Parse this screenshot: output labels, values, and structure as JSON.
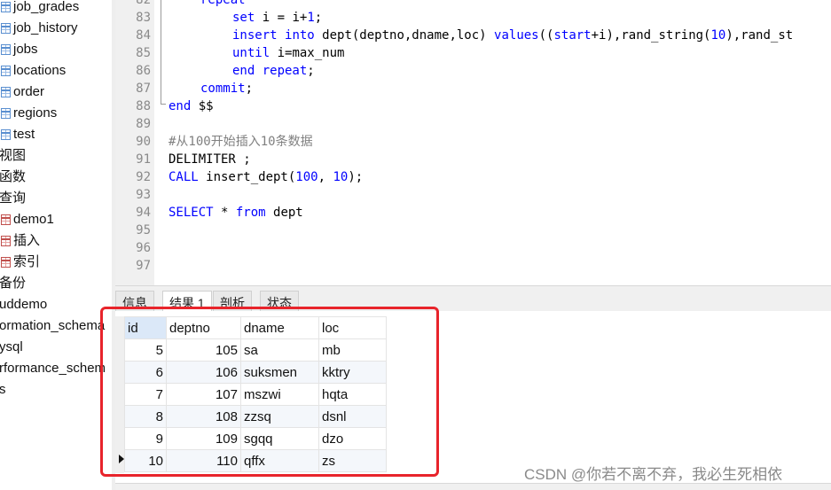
{
  "sidebar": {
    "items": [
      {
        "label": "job_grades",
        "icon": "table-icon"
      },
      {
        "label": "job_history",
        "icon": "table-icon"
      },
      {
        "label": "jobs",
        "icon": "table-icon"
      },
      {
        "label": "locations",
        "icon": "table-icon"
      },
      {
        "label": "order",
        "icon": "table-icon"
      },
      {
        "label": "regions",
        "icon": "table-icon"
      },
      {
        "label": "test",
        "icon": "table-icon"
      },
      {
        "label": "视图",
        "icon": ""
      },
      {
        "label": "函数",
        "icon": ""
      },
      {
        "label": "查询",
        "icon": ""
      },
      {
        "label": "demo1",
        "icon": "query-icon"
      },
      {
        "label": "插入",
        "icon": "query-icon"
      },
      {
        "label": "索引",
        "icon": "query-icon"
      },
      {
        "label": "备份",
        "icon": ""
      },
      {
        "label": "uddemo",
        "icon": ""
      },
      {
        "label": "ormation_schema",
        "icon": ""
      },
      {
        "label": "ysql",
        "icon": ""
      },
      {
        "label": "rformance_schem",
        "icon": ""
      },
      {
        "label": "s",
        "icon": ""
      }
    ]
  },
  "editor": {
    "line_numbers": [
      "82",
      "83",
      "84",
      "85",
      "86",
      "87",
      "88",
      "89",
      "90",
      "91",
      "92",
      "93",
      "94",
      "95",
      "96",
      "97"
    ],
    "lines": {
      "l82_kw": "repeat",
      "l83_kw": "set",
      "l83_rest": " i = i+",
      "l83_num": "1",
      "l83_end": ";",
      "l84_kw1": "insert",
      "l84_kw2": "into",
      "l84_mid": " dept(deptno,dname,loc) ",
      "l84_kw3": "values",
      "l84_p1": "((",
      "l84_kw4": "start",
      "l84_p2": "+i),rand_string(",
      "l84_num": "10",
      "l84_p3": "),rand_st",
      "l85_kw": "until",
      "l85_rest": " i=max_num",
      "l86_kw": "end repeat",
      "l86_end": ";",
      "l87_kw": "commit",
      "l87_end": ";",
      "l88_kw": "end",
      "l88_rest": " $$",
      "l90_comment": "#从100开始插入10条数据",
      "l91": "DELIMITER ;",
      "l92_kw": "CALL",
      "l92_rest": " insert_dept(",
      "l92_num1": "100",
      "l92_sep": ", ",
      "l92_num2": "10",
      "l92_end": ");",
      "l94_kw": "SELECT",
      "l94_mid": " * ",
      "l94_kw2": "from",
      "l94_rest": " dept"
    }
  },
  "result_tabs": [
    "信息",
    "结果 1",
    "剖析",
    "状态"
  ],
  "active_tab": "结果 1",
  "grid": {
    "columns": [
      "id",
      "deptno",
      "dname",
      "loc"
    ],
    "rows": [
      [
        "5",
        "105",
        "sa",
        "mb"
      ],
      [
        "6",
        "106",
        "suksmen",
        "kktry"
      ],
      [
        "7",
        "107",
        "mszwi",
        "hqta"
      ],
      [
        "8",
        "108",
        "zzsq",
        "dsnl"
      ],
      [
        "9",
        "109",
        "sgqq",
        "dzo"
      ],
      [
        "10",
        "110",
        "qffx",
        "zs"
      ]
    ],
    "current_row_index": 5
  },
  "watermark": "CSDN @你若不离不弃，我必生死相依",
  "colors": {
    "keyword": "#0000ff",
    "comment": "#808080",
    "highlight_box": "#e8242b",
    "selected_header": "#dbe8f8"
  }
}
